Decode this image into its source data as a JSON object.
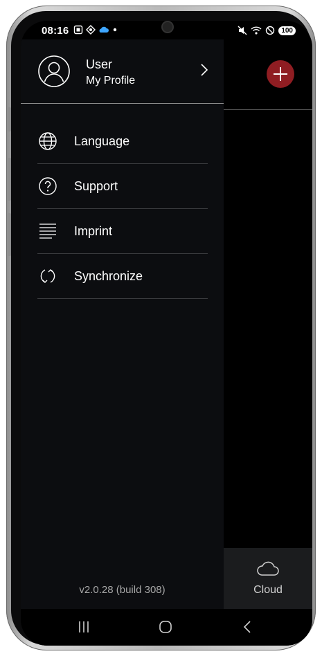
{
  "status_bar": {
    "time": "08:16",
    "battery": "100",
    "left_icons": [
      "screenshot-icon",
      "vpn-icon",
      "weather-icon",
      "notification-dot-icon"
    ],
    "right_icons": [
      "mute-icon",
      "wifi-icon",
      "dnd-icon"
    ]
  },
  "drawer": {
    "profile": {
      "name": "User",
      "subtitle": "My Profile"
    },
    "menu": [
      {
        "label": "Language",
        "icon": "globe-icon"
      },
      {
        "label": "Support",
        "icon": "help-circle-icon"
      },
      {
        "label": "Imprint",
        "icon": "lines-icon"
      },
      {
        "label": "Synchronize",
        "icon": "sync-icon"
      }
    ],
    "version": "v2.0.28 (build 308)"
  },
  "background_app": {
    "fab_icon": "plus-icon",
    "bottom_tab": {
      "label": "Cloud",
      "icon": "cloud-icon"
    }
  },
  "nav_bar": {
    "buttons": [
      "recents-icon",
      "home-icon",
      "back-icon"
    ]
  },
  "colors": {
    "drawer_bg": "#0c0d10",
    "accent_fab": "#8f1d22",
    "divider": "#3b3c3f",
    "version_text": "#a6a6a6"
  }
}
